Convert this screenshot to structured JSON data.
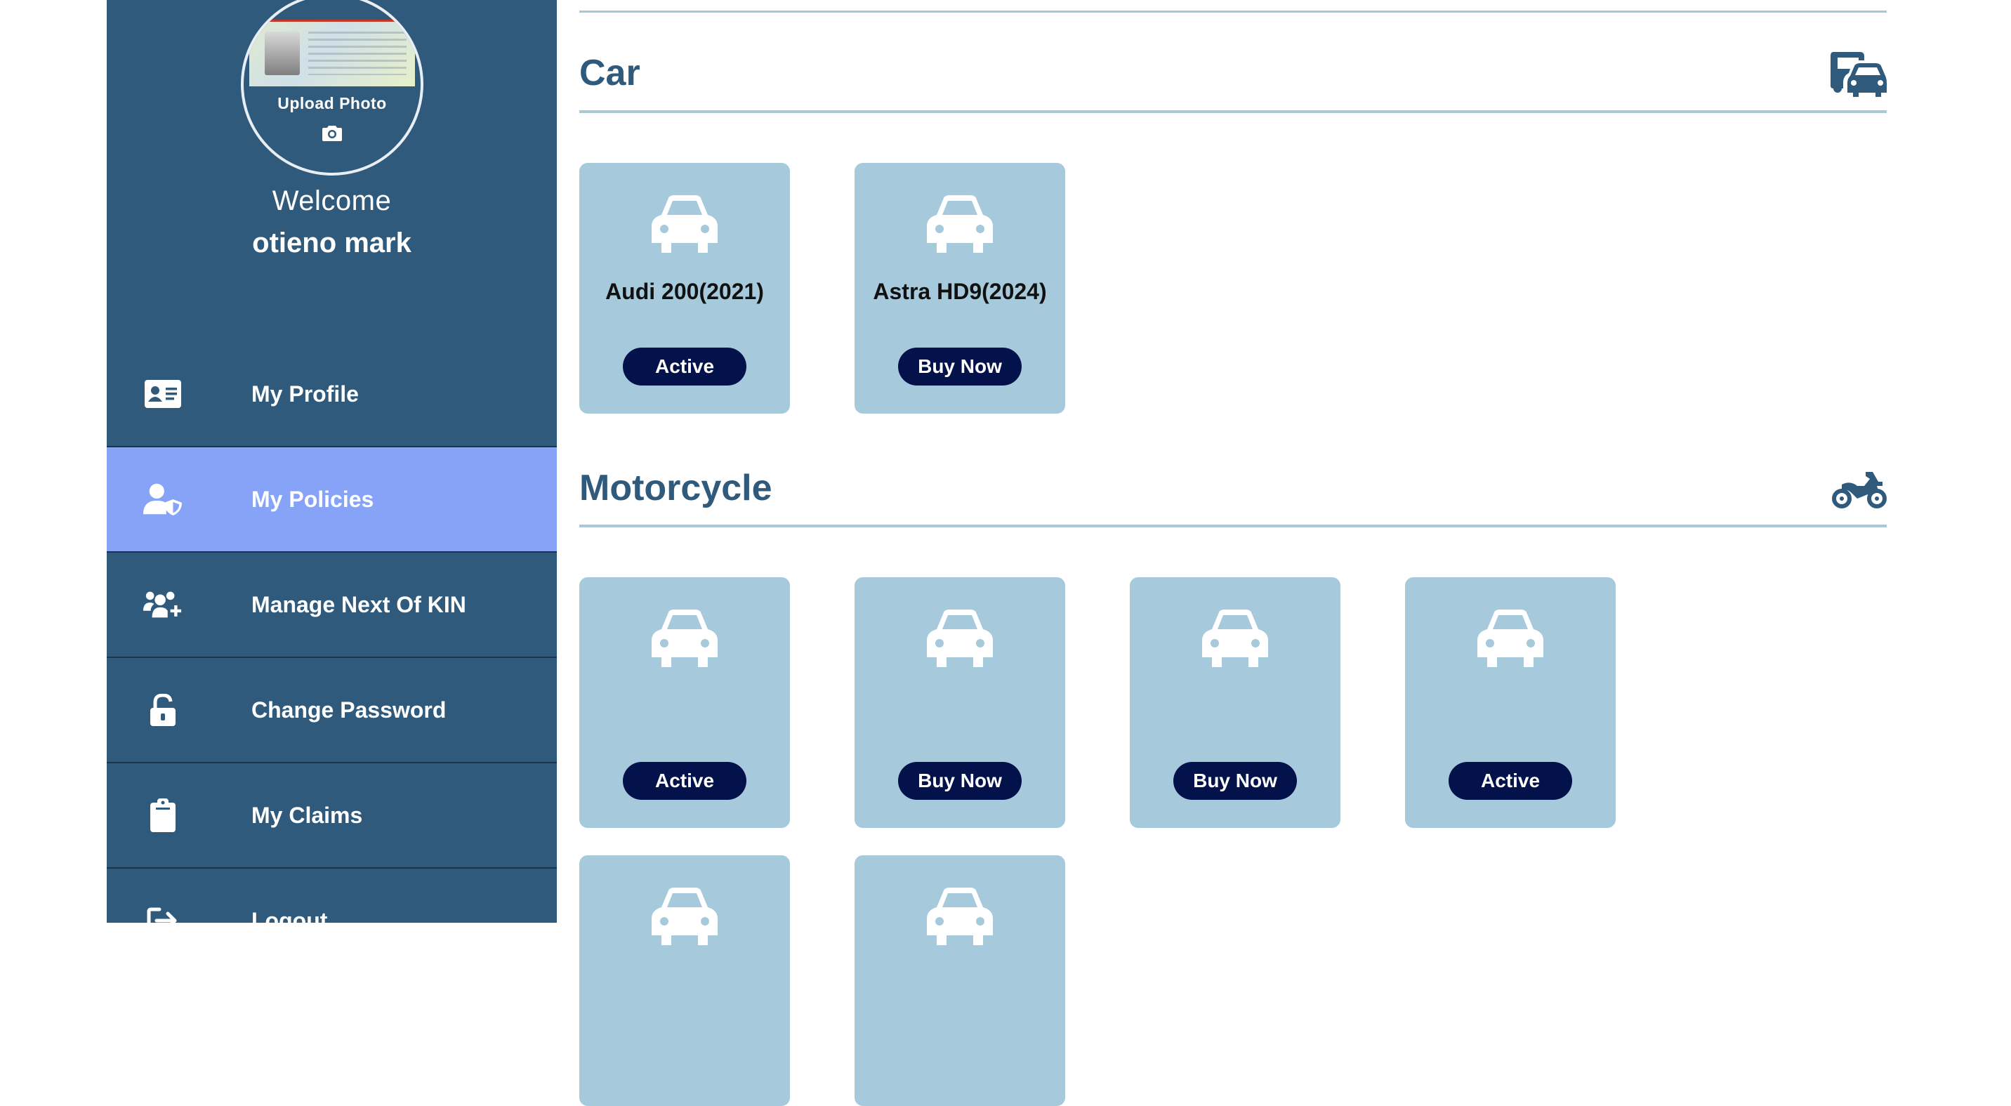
{
  "sidebar": {
    "upload_photo_label": "Upload Photo",
    "welcome_text": "Welcome",
    "user_name": "otieno mark",
    "items": [
      {
        "label": "My Profile",
        "icon": "id-card-icon",
        "active": false
      },
      {
        "label": "My Policies",
        "icon": "user-shield-icon",
        "active": true
      },
      {
        "label": "Manage Next Of KIN",
        "icon": "users-plus-icon",
        "active": false
      },
      {
        "label": "Change Password",
        "icon": "unlock-icon",
        "active": false
      },
      {
        "label": "My Claims",
        "icon": "clipboard-icon",
        "active": false
      },
      {
        "label": "Logout",
        "icon": "logout-icon",
        "active": false
      }
    ]
  },
  "sections": {
    "car": {
      "title": "Car",
      "icon": "truck-car-icon",
      "cards": [
        {
          "name": "Audi 200(2021)",
          "button": "Active"
        },
        {
          "name": "Astra HD9(2024)",
          "button": "Buy Now"
        }
      ]
    },
    "motorcycle": {
      "title": "Motorcycle",
      "icon": "motorcycle-icon",
      "cards": [
        {
          "name": "",
          "button": "Active"
        },
        {
          "name": "",
          "button": "Buy Now"
        },
        {
          "name": "",
          "button": "Buy Now"
        },
        {
          "name": "",
          "button": "Active"
        },
        {
          "name": "",
          "button": ""
        },
        {
          "name": "",
          "button": ""
        }
      ]
    }
  },
  "colors": {
    "sidebar_bg": "#305a7c",
    "active_item_bg": "#86a3f8",
    "card_bg": "#a6c9db",
    "button_bg": "#03124a",
    "title_color": "#305a7c",
    "rule_color": "#a8c7d7"
  }
}
